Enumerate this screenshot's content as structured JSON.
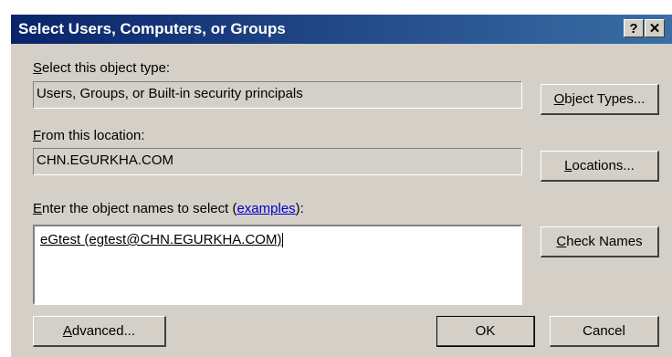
{
  "window": {
    "title": "Select Users, Computers, or Groups",
    "help_glyph": "?",
    "close_glyph": "✕"
  },
  "object_type": {
    "label_key": "S",
    "label_rest": "elect this object type:",
    "value": "Users, Groups, or Built-in security principals",
    "button_key": "O",
    "button_rest": "bject Types..."
  },
  "location": {
    "label_key": "F",
    "label_rest": "rom this location:",
    "value": "CHN.EGURKHA.COM",
    "button_key": "L",
    "button_rest": "ocations..."
  },
  "names": {
    "label_key": "E",
    "label_rest": "nter the object names to select (",
    "label_link": "examples",
    "label_end": "):",
    "value": "eGtest (egtest@CHN.EGURKHA.COM)",
    "check_key": "C",
    "check_rest": "heck Names"
  },
  "footer": {
    "advanced_key": "A",
    "advanced_rest": "dvanced...",
    "ok_label": "OK",
    "cancel_label": "Cancel"
  }
}
